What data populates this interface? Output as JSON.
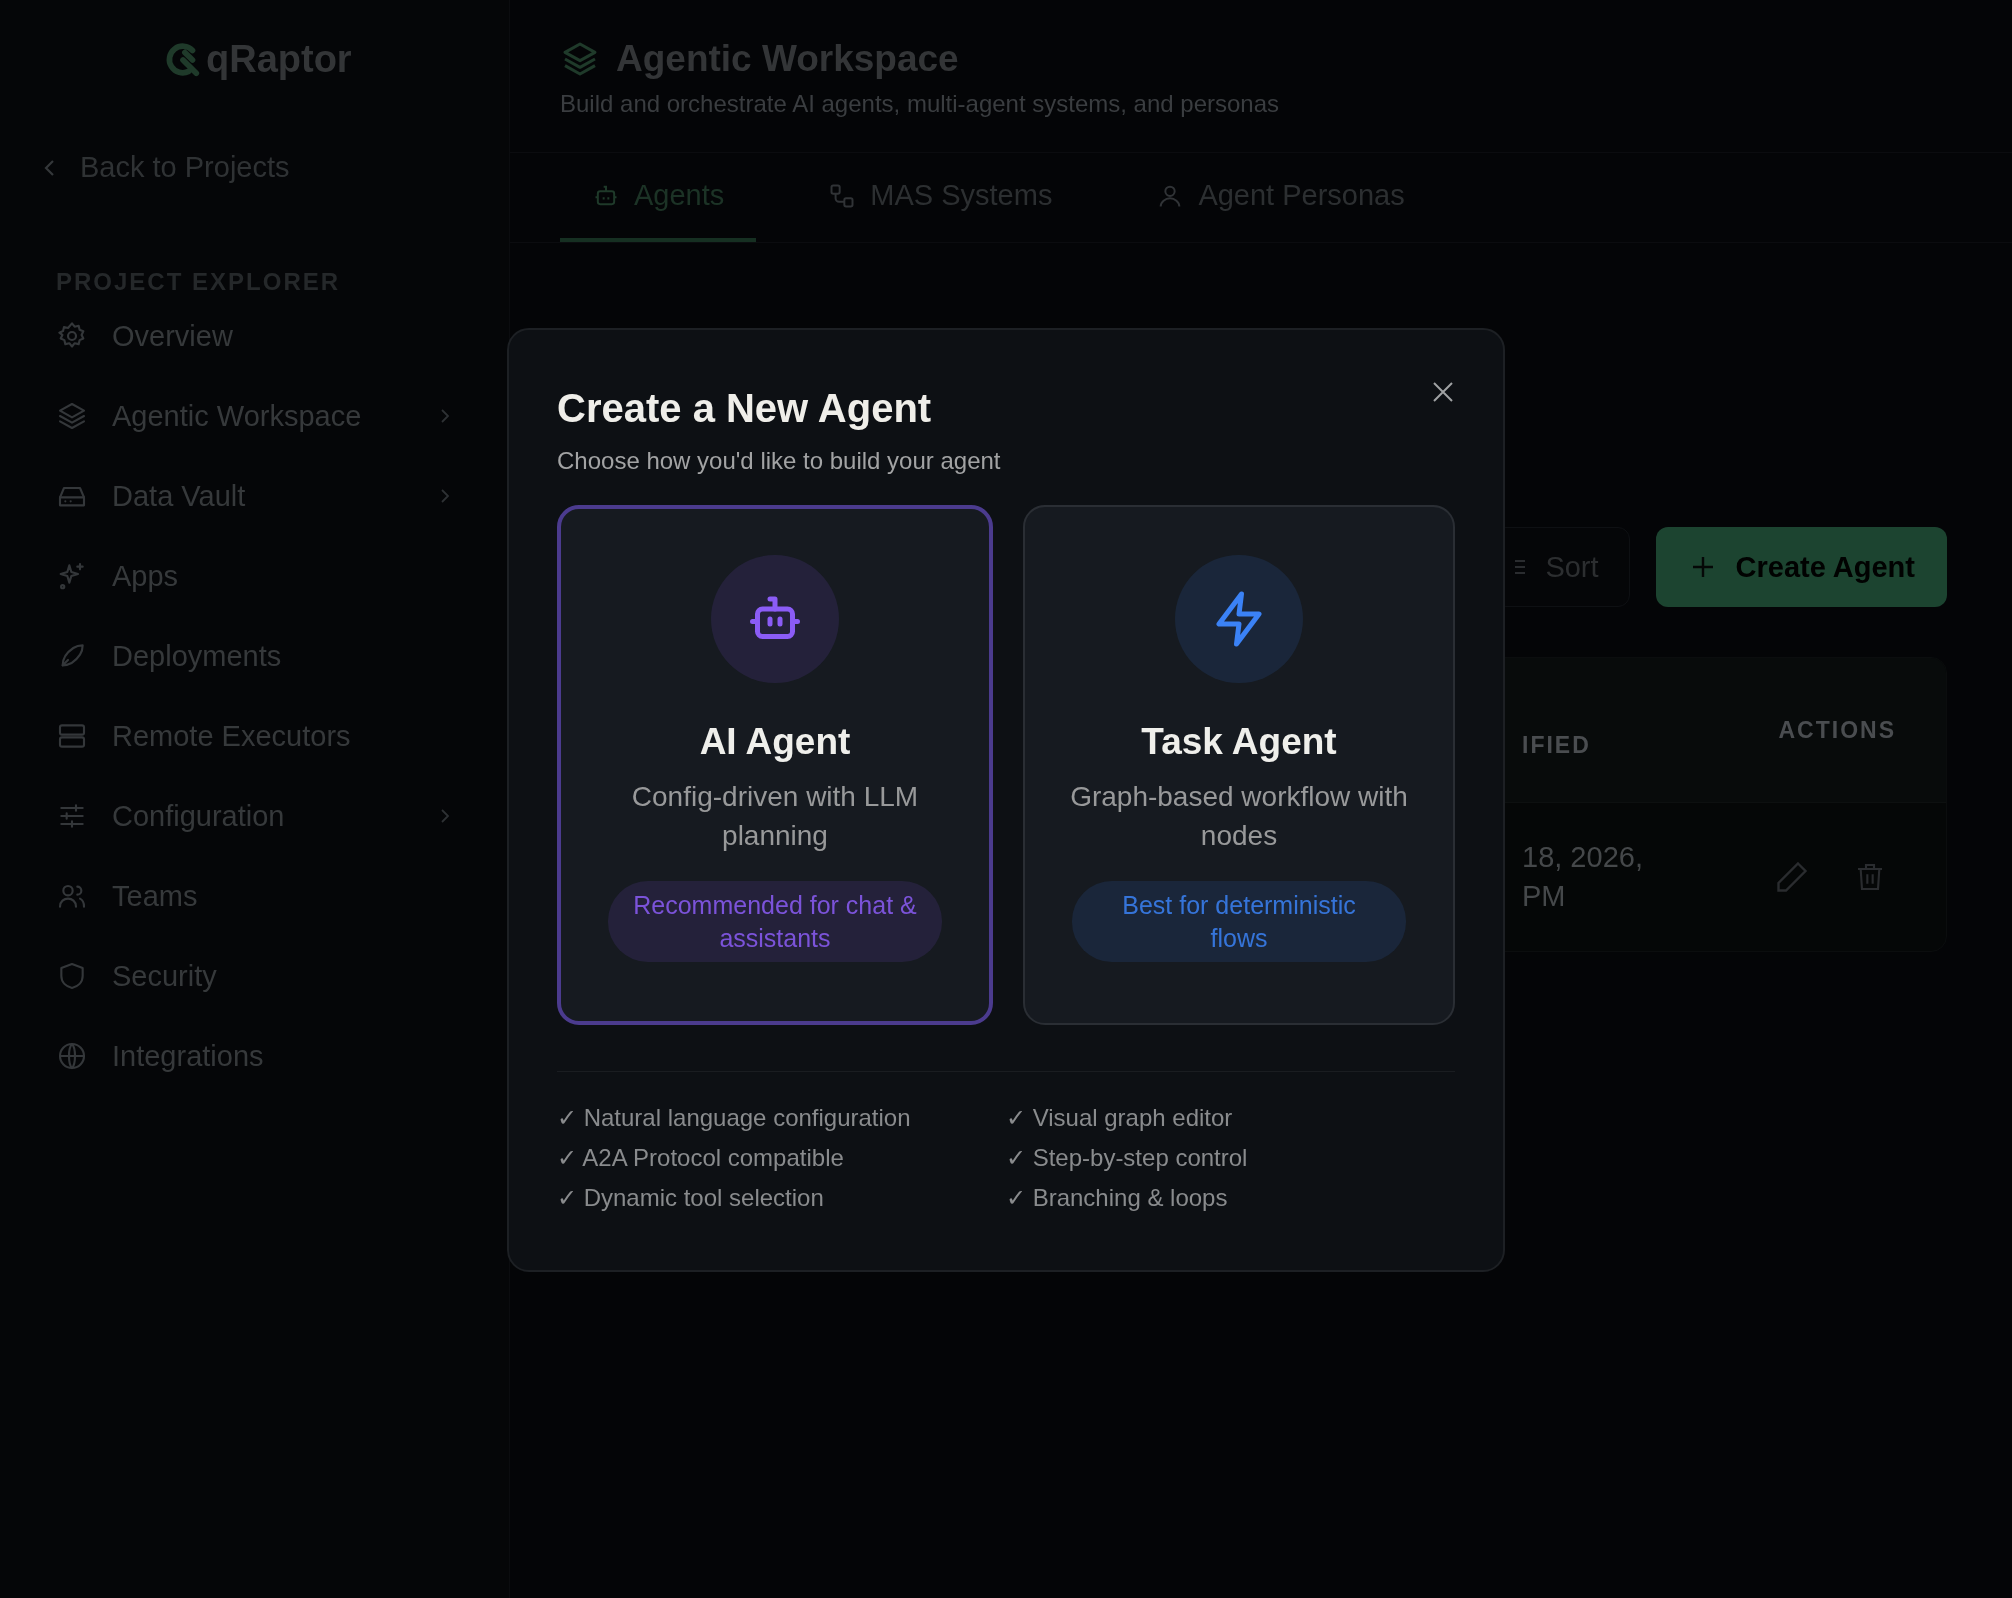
{
  "sidebar": {
    "logo": "qRaptor",
    "back_link": "Back to Projects",
    "section_title": "PROJECT EXPLORER",
    "items": [
      {
        "label": "Overview",
        "expandable": false
      },
      {
        "label": "Agentic Workspace",
        "expandable": true
      },
      {
        "label": "Data Vault",
        "expandable": true
      },
      {
        "label": "Apps",
        "expandable": false
      },
      {
        "label": "Deployments",
        "expandable": false
      },
      {
        "label": "Remote Executors",
        "expandable": false
      },
      {
        "label": "Configuration",
        "expandable": true
      },
      {
        "label": "Teams",
        "expandable": false
      },
      {
        "label": "Security",
        "expandable": false
      },
      {
        "label": "Integrations",
        "expandable": false
      }
    ]
  },
  "header": {
    "title": "Agentic Workspace",
    "subtitle": "Build and orchestrate AI agents, multi-agent systems, and personas"
  },
  "tabs": [
    {
      "label": "Agents",
      "selected": true
    },
    {
      "label": "MAS Systems",
      "selected": false
    },
    {
      "label": "Agent Personas",
      "selected": false
    }
  ],
  "toolbar": {
    "sort_button": "Sort",
    "create_button": "Create Agent"
  },
  "table": {
    "columns": [
      "IFIED",
      "ACTIONS"
    ],
    "rows": [
      {
        "column_1": "18, 2026, PM"
      }
    ]
  },
  "modal": {
    "title": "Create a New Agent",
    "subtitle": "Choose how you'd like to build your agent",
    "options": [
      {
        "title": "AI Agent",
        "description": "Config-driven with LLM planning",
        "badge": "Recommended for chat & assistants",
        "selected": true,
        "color": "#8b5cf6"
      },
      {
        "title": "Task Agent",
        "description": "Graph-based workflow with nodes",
        "badge": "Best for deterministic flows",
        "selected": false,
        "color": "#3b82f6"
      }
    ],
    "features": [
      [
        "✓ Natural language configuration",
        "✓ A2A Protocol compatible",
        "✓ Dynamic tool selection"
      ],
      [
        "✓ Visual graph editor",
        "✓ Step-by-step control",
        "✓ Branching & loops"
      ]
    ]
  }
}
